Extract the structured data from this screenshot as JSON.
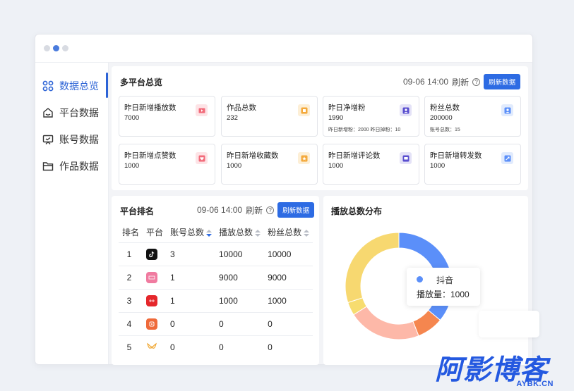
{
  "colors": {
    "accent": "#2d6be3",
    "nav_active": "#2c63d6",
    "donut": [
      "#5b8ff9",
      "#f5864f",
      "#fdb8a8",
      "#f7dc6f",
      "#f7d870"
    ]
  },
  "sidebar": {
    "items": [
      {
        "label": "数据总览",
        "icon": "grid-icon",
        "active": true
      },
      {
        "label": "平台数据",
        "icon": "home-icon",
        "active": false
      },
      {
        "label": "账号数据",
        "icon": "monitor-icon",
        "active": false
      },
      {
        "label": "作品数据",
        "icon": "folder-icon",
        "active": false
      }
    ]
  },
  "overview": {
    "title": "多平台总览",
    "refresh_time": "09-06 14:00",
    "refresh_label": "刷新",
    "refresh_button": "刷新数据",
    "cards": [
      {
        "label": "昨日新增播放数",
        "value": "7000",
        "sub": "",
        "icon": "play-icon",
        "color": "#f26b7a"
      },
      {
        "label": "作品总数",
        "value": "232",
        "sub": "",
        "icon": "works-icon",
        "color": "#f4a93b"
      },
      {
        "label": "昨日净增粉",
        "value": "1990",
        "sub": "昨日新增粉：2000  昨日掉粉：10",
        "icon": "user-icon",
        "color": "#5a4fcf"
      },
      {
        "label": "粉丝总数",
        "value": "200000",
        "sub": "账号总数：15",
        "icon": "fans-icon",
        "color": "#5b8ff9"
      },
      {
        "label": "昨日新增点赞数",
        "value": "1000",
        "sub": "",
        "icon": "like-icon",
        "color": "#f26b7a"
      },
      {
        "label": "昨日新增收藏数",
        "value": "1000",
        "sub": "",
        "icon": "star-icon",
        "color": "#f4a93b"
      },
      {
        "label": "昨日新增评论数",
        "value": "1000",
        "sub": "",
        "icon": "comment-icon",
        "color": "#5a4fcf"
      },
      {
        "label": "昨日新增转发数",
        "value": "1000",
        "sub": "",
        "icon": "share-icon",
        "color": "#5b8ff9"
      }
    ]
  },
  "ranking": {
    "title": "平台排名",
    "refresh_time": "09-06 14:00",
    "refresh_label": "刷新",
    "refresh_button": "刷新数据",
    "columns": [
      "排名",
      "平台",
      "账号总数",
      "播放总数",
      "粉丝总数"
    ],
    "rows": [
      {
        "rank": "1",
        "platform_icon": "douyin-icon",
        "accounts": "3",
        "plays": "10000",
        "fans": "10000"
      },
      {
        "rank": "2",
        "platform_icon": "xiaohongshu-icon",
        "accounts": "1",
        "plays": "9000",
        "fans": "9000"
      },
      {
        "rank": "3",
        "platform_icon": "kuaishou-icon",
        "accounts": "1",
        "plays": "1000",
        "fans": "1000"
      },
      {
        "rank": "4",
        "platform_icon": "bilibili-icon",
        "accounts": "0",
        "plays": "0",
        "fans": "0"
      },
      {
        "rank": "5",
        "platform_icon": "video-channel-icon",
        "accounts": "0",
        "plays": "0",
        "fans": "0"
      }
    ]
  },
  "distribution": {
    "title": "播放总数分布",
    "tooltip": {
      "name": "抖音",
      "value_label": "播放量：1000"
    }
  },
  "chart_data": {
    "type": "pie",
    "title": "播放总数分布",
    "categories": [
      "抖音",
      "",
      "",
      "",
      ""
    ],
    "values": [
      36,
      8,
      22,
      4,
      30
    ]
  },
  "watermark": {
    "main": "阿影博客",
    "sub": "AYBK.CN"
  }
}
